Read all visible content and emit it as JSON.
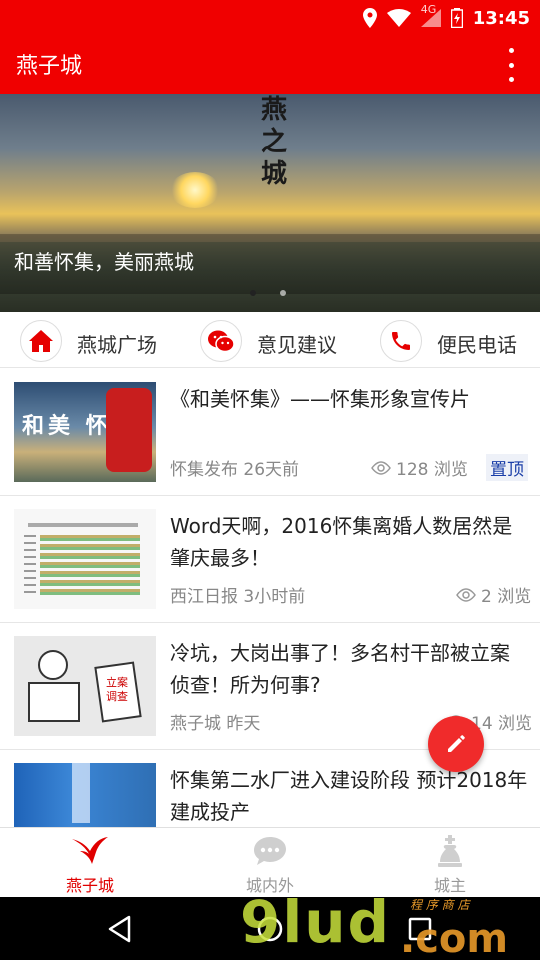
{
  "status_bar": {
    "network": "4G",
    "time": "13:45",
    "icons": [
      "location-icon",
      "wifi-icon",
      "signal-icon",
      "battery-icon"
    ]
  },
  "app_bar": {
    "title": "燕子城",
    "menu_icon": "overflow-menu-icon",
    "color": "#f00000"
  },
  "banner": {
    "caption": "和善怀集，美丽燕城",
    "calligraphy": "燕之城",
    "slide_count": 2,
    "active_slide": 1
  },
  "quick_links": [
    {
      "label": "燕城广场",
      "icon": "home-icon"
    },
    {
      "label": "意见建议",
      "icon": "wechat-icon"
    },
    {
      "label": "便民电话",
      "icon": "phone-icon"
    }
  ],
  "news": [
    {
      "title": "《和美怀集》——怀集形象宣传片",
      "source_time": "怀集发布 26天前",
      "views": "128 浏览",
      "badge": "置顶",
      "thumb_text": "和美 怀集"
    },
    {
      "title": "Word天啊，2016怀集离婚人数居然是肇庆最多！",
      "source_time": "西江日报 3小时前",
      "views": "2 浏览"
    },
    {
      "title": "冷坑，大岗出事了！多名村干部被立案侦查！所为何事?",
      "source_time": "燕子城 昨天",
      "views": "14 浏览",
      "thumb_text": "立案 调查"
    },
    {
      "title": "怀集第二水厂进入建设阶段 预计2018年建成投产",
      "source_time": "",
      "views": ""
    }
  ],
  "fab": {
    "icon": "edit-pencil-icon"
  },
  "tabs": [
    {
      "label": "燕子城",
      "icon": "swallow-icon",
      "active": true
    },
    {
      "label": "城内外",
      "icon": "chat-bubble-icon",
      "active": false
    },
    {
      "label": "城主",
      "icon": "king-icon",
      "active": false
    }
  ],
  "nav_bar": {
    "buttons": [
      "back-icon",
      "home-circle-icon",
      "recents-icon"
    ]
  },
  "watermark": {
    "main": "9lud",
    "suffix": ".com",
    "sub": "程 序 商 店"
  }
}
